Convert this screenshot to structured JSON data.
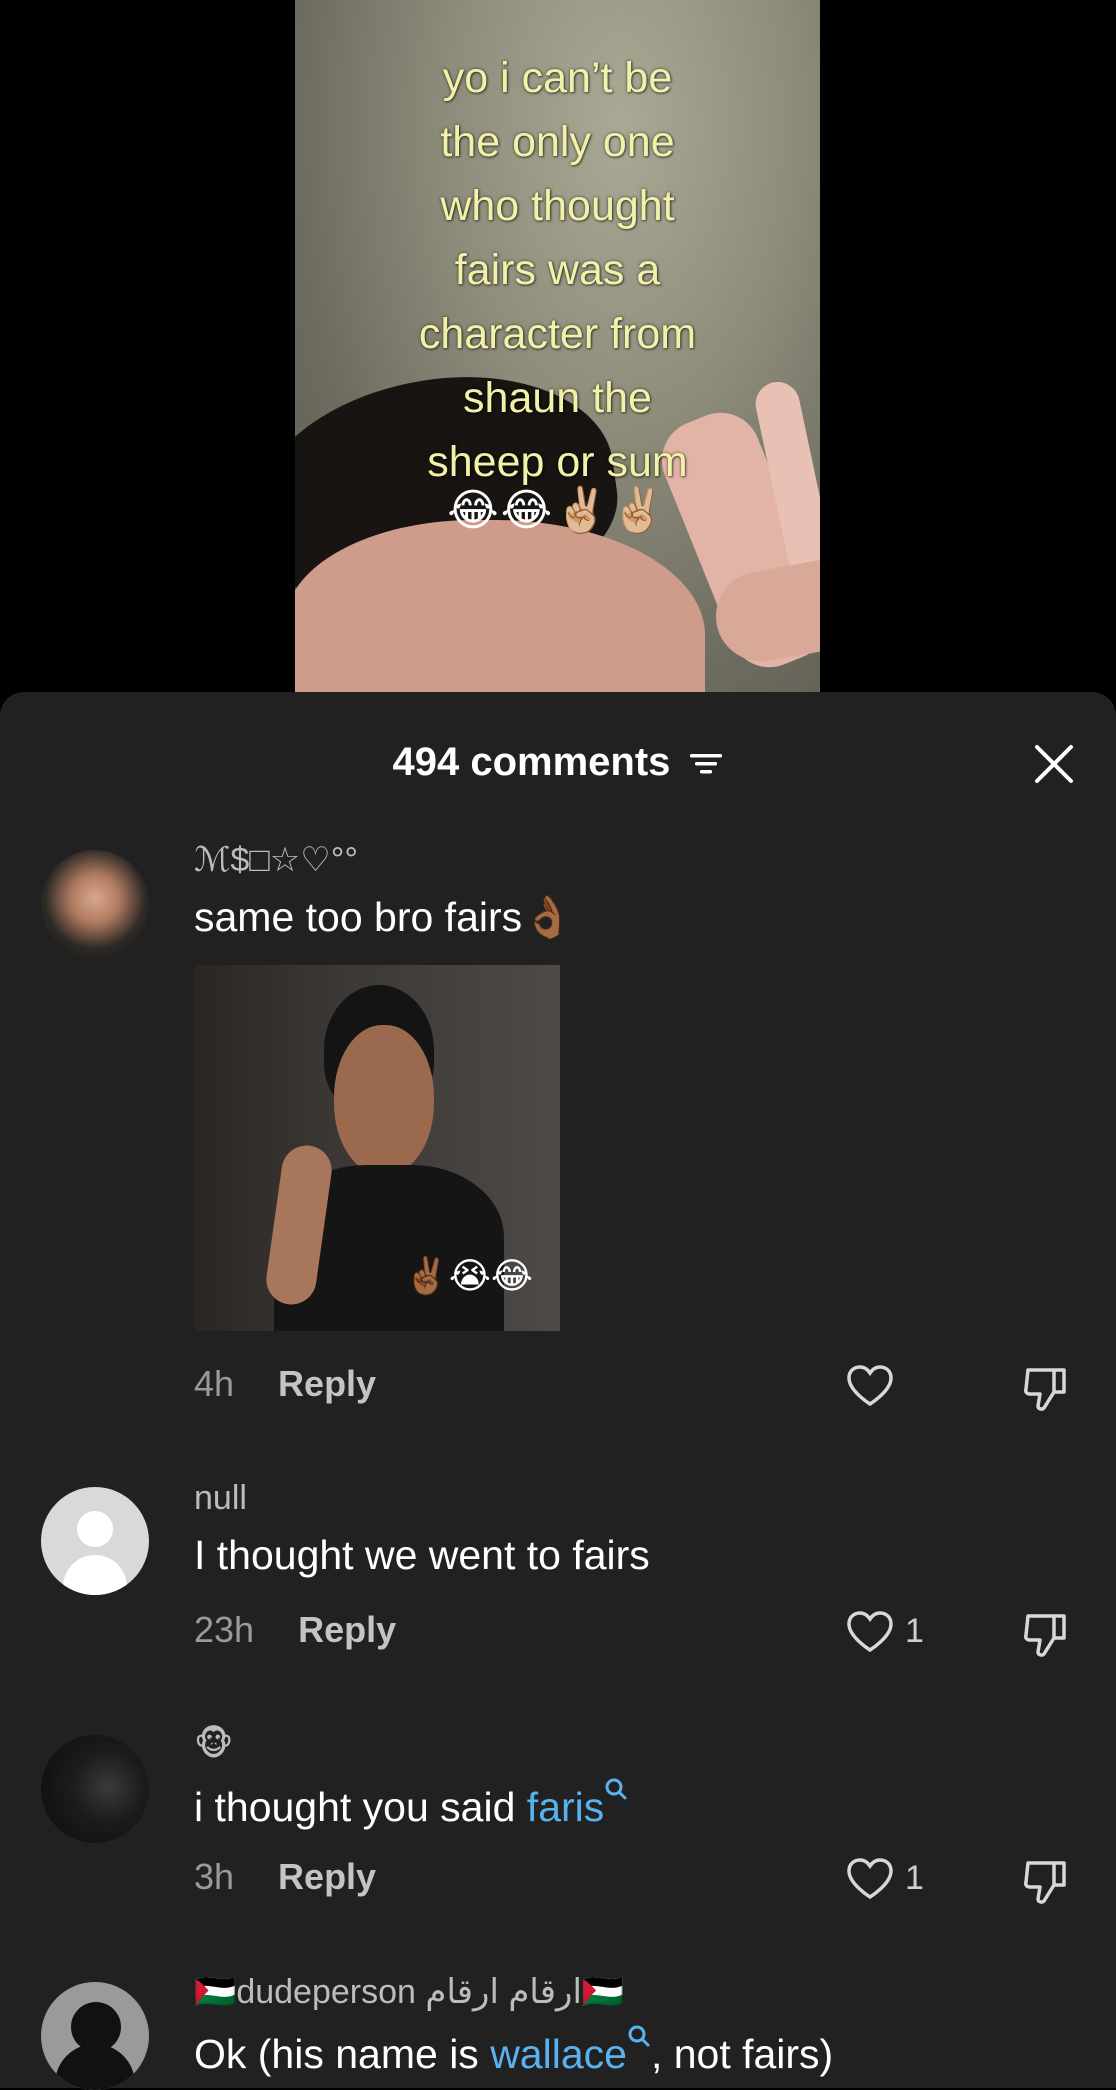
{
  "video": {
    "caption": "yo i can’t be\nthe only one\nwho thought\nfairs was a\ncharacter from\nshaun the\nsheep or sum",
    "caption_emoji": "😂😂✌🏼✌🏼"
  },
  "comments_panel": {
    "count_label": "494 comments",
    "sort_icon": "sort-icon",
    "close_icon": "close-icon"
  },
  "comments": [
    {
      "username": "ℳ$□☆♡°°",
      "text": "same too bro fairs👌🏾",
      "gif_emoji": "✌🏾😭😂",
      "time": "4h",
      "reply_label": "Reply",
      "likes": ""
    },
    {
      "username": "null",
      "text": "I thought we went to fairs",
      "time": "23h",
      "reply_label": "Reply",
      "likes": "1"
    },
    {
      "username": "🐵",
      "text_prefix": "i thought you said ",
      "text_link": "faris",
      "time": "3h",
      "reply_label": "Reply",
      "likes": "1"
    },
    {
      "username": "🇵🇸dudeperson ارقام ارقام🇵🇸",
      "text_prefix": "Ok (his name is ",
      "text_link": "wallace",
      "text_suffix": ", not fairs)"
    }
  ],
  "colors": {
    "sheet_bg": "#212121",
    "link": "#5ab1ef",
    "caption": "#f3f0a8"
  }
}
